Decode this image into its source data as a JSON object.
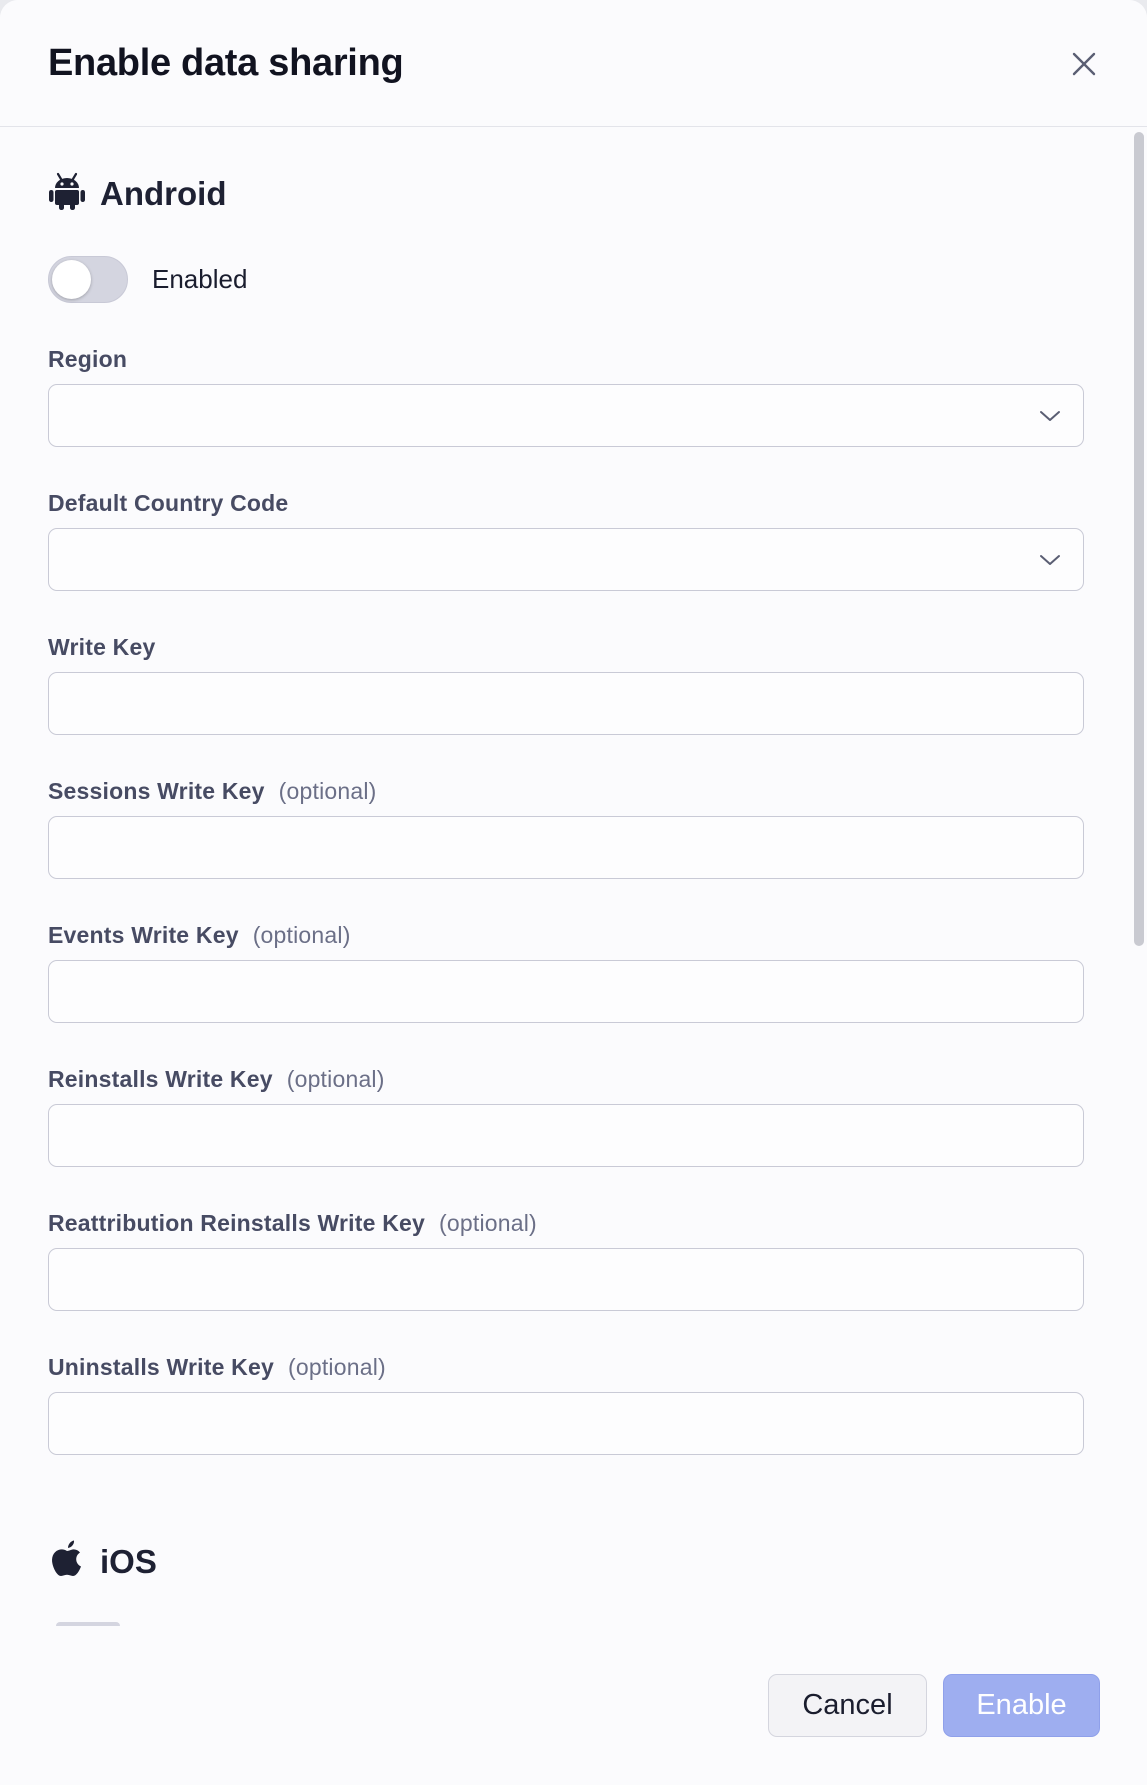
{
  "dialog": {
    "title": "Enable data sharing",
    "close_icon": "close-icon"
  },
  "android": {
    "name": "Android",
    "icon": "android-icon",
    "toggle": {
      "label": "Enabled",
      "on": false
    },
    "fields": [
      {
        "label": "Region",
        "optional": "",
        "type": "select",
        "value": ""
      },
      {
        "label": "Default Country Code",
        "optional": "",
        "type": "select",
        "value": ""
      },
      {
        "label": "Write Key",
        "optional": "",
        "type": "text",
        "value": ""
      },
      {
        "label": "Sessions Write Key",
        "optional": "(optional)",
        "type": "text",
        "value": ""
      },
      {
        "label": "Events Write Key",
        "optional": "(optional)",
        "type": "text",
        "value": ""
      },
      {
        "label": "Reinstalls Write Key",
        "optional": "(optional)",
        "type": "text",
        "value": ""
      },
      {
        "label": "Reattribution Reinstalls Write Key",
        "optional": "(optional)",
        "type": "text",
        "value": ""
      },
      {
        "label": "Uninstalls Write Key",
        "optional": "(optional)",
        "type": "text",
        "value": ""
      }
    ]
  },
  "ios": {
    "name": "iOS",
    "icon": "apple-icon"
  },
  "footer": {
    "cancel_label": "Cancel",
    "enable_label": "Enable"
  },
  "colors": {
    "enable_button": "#9eaef0",
    "toggle_off": "#d4d5e0",
    "text_dark": "#111320"
  }
}
